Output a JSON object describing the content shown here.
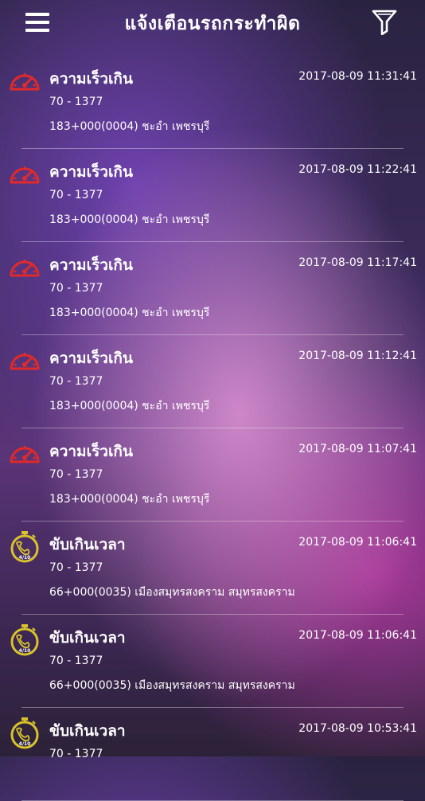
{
  "header": {
    "title": "แจ้งเตือนรถกระทำผิด",
    "menu_icon": "hamburger-menu-icon",
    "filter_icon": "filter-icon"
  },
  "colors": {
    "speed_icon": "#e02a2a",
    "time_icon": "#d8c42a"
  },
  "alerts": [
    {
      "type": "speed",
      "icon": "speedometer-icon",
      "violation": "ความเร็วเกิน",
      "datetime": "2017-08-09  11:31:41",
      "plate": "70  -  1377",
      "location": "183+000(0004)  ชะอำ  เพชรบุรี"
    },
    {
      "type": "speed",
      "icon": "speedometer-icon",
      "violation": "ความเร็วเกิน",
      "datetime": "2017-08-09  11:22:41",
      "plate": "70  -  1377",
      "location": "183+000(0004)  ชะอำ  เพชรบุรี"
    },
    {
      "type": "speed",
      "icon": "speedometer-icon",
      "violation": "ความเร็วเกิน",
      "datetime": "2017-08-09  11:17:41",
      "plate": "70  -  1377",
      "location": "183+000(0004)  ชะอำ  เพชรบุรี"
    },
    {
      "type": "speed",
      "icon": "speedometer-icon",
      "violation": "ความเร็วเกิน",
      "datetime": "2017-08-09  11:12:41",
      "plate": "70  -  1377",
      "location": "183+000(0004)  ชะอำ  เพชรบุรี"
    },
    {
      "type": "speed",
      "icon": "speedometer-icon",
      "violation": "ความเร็วเกิน",
      "datetime": "2017-08-09  11:07:41",
      "plate": "70  -  1377",
      "location": "183+000(0004)  ชะอำ  เพชรบุรี"
    },
    {
      "type": "time",
      "icon": "driving-time-icon",
      "icon_text": "4/10",
      "violation": "ขับเกินเวลา",
      "datetime": "2017-08-09  11:06:41",
      "plate": "70  -  1377",
      "location": "66+000(0035)  เมืองสมุทรสงคราม  สมุทรสงคราม"
    },
    {
      "type": "time",
      "icon": "driving-time-icon",
      "icon_text": "4/10",
      "violation": "ขับเกินเวลา",
      "datetime": "2017-08-09  11:06:41",
      "plate": "70  -  1377",
      "location": "66+000(0035)  เมืองสมุทรสงคราม  สมุทรสงคราม"
    },
    {
      "type": "time",
      "icon": "driving-time-icon",
      "icon_text": "4/10",
      "violation": "ขับเกินเวลา",
      "datetime": "2017-08-09  10:53:41",
      "plate": "70  -  1377",
      "location": ""
    }
  ]
}
